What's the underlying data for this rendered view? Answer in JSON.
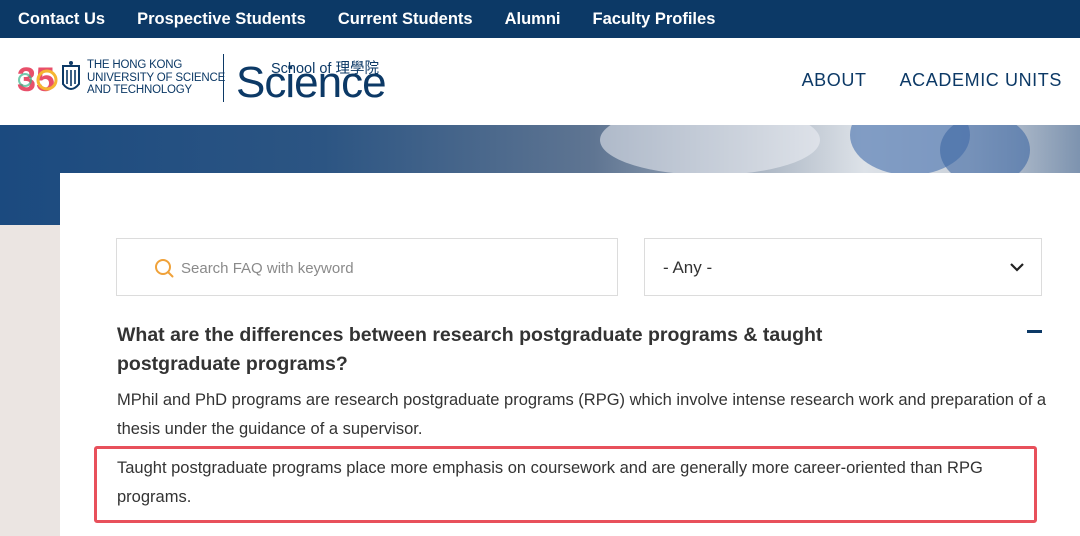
{
  "topbar": {
    "links": [
      "Contact Us",
      "Prospective Students",
      "Current Students",
      "Alumni",
      "Faculty Profiles"
    ]
  },
  "header": {
    "anniversary": "35",
    "university_lines": [
      "THE HONG KONG",
      "UNIVERSITY OF SCIENCE",
      "AND TECHNOLOGY"
    ],
    "school_of": "School of 理學院",
    "science": "Science",
    "nav": [
      "ABOUT",
      "ACADEMIC UNITS"
    ]
  },
  "search": {
    "placeholder": "Search FAQ with keyword",
    "value": ""
  },
  "filter": {
    "selected": "- Any -"
  },
  "faq": {
    "question": "What are the differences between research postgraduate programs & taught postgraduate programs?",
    "answer_1": "MPhil and PhD programs are research postgraduate programs (RPG) which involve intense research work and preparation of a thesis under the guidance of a supervisor.",
    "answer_2": "Taught postgraduate programs place more emphasis on coursework and are generally more career-oriented than RPG programs."
  },
  "colors": {
    "brand_navy": "#0c3966",
    "highlight_red": "#e8505b",
    "search_icon_orange": "#f0a23a"
  }
}
